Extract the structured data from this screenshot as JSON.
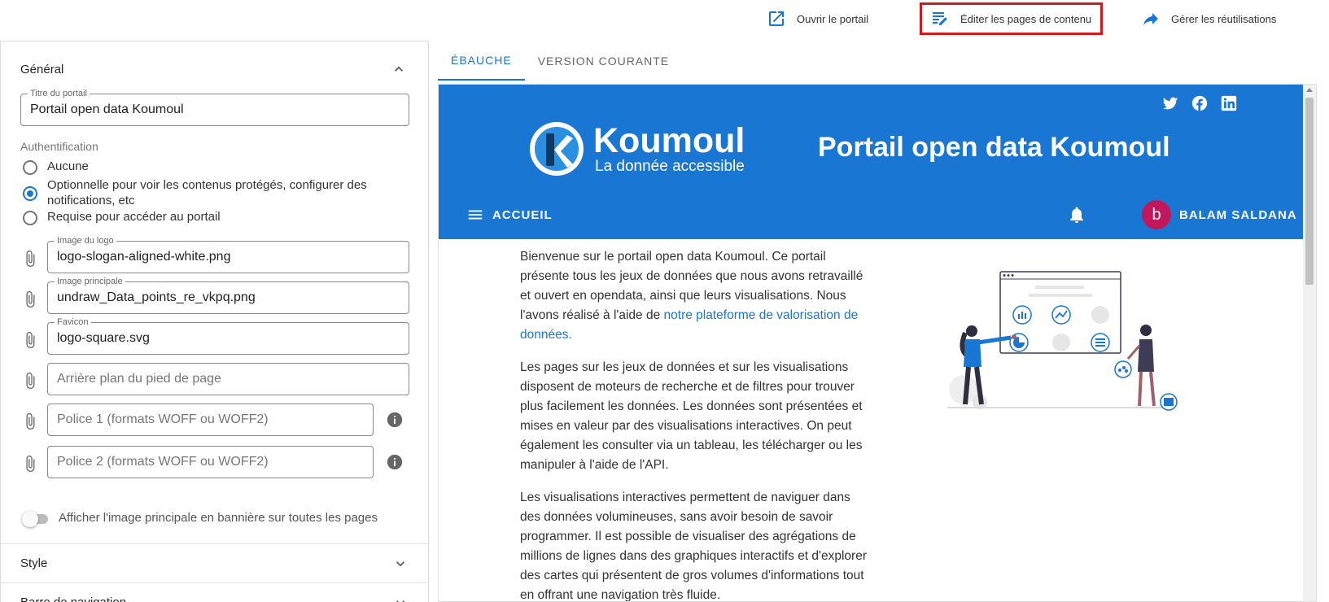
{
  "toolbar": {
    "open_portal": "Ouvrir le portail",
    "edit_pages": "Éditer les pages de contenu",
    "manage_reuses": "Gérer les réutilisations",
    "highlight_color": "#d4171d"
  },
  "sidebar": {
    "general": {
      "title": "Général",
      "portal_title": {
        "label": "Titre du portail",
        "value": "Portail open data Koumoul"
      },
      "auth": {
        "label": "Authentification",
        "options": [
          "Aucune",
          "Optionnelle pour voir les contenus protégés, configurer des notifications, etc",
          "Requise pour accéder au portail"
        ],
        "selected": 1
      },
      "logo": {
        "label": "Image du logo",
        "value": "logo-slogan-aligned-white.png"
      },
      "main_image": {
        "label": "Image principale",
        "value": "undraw_Data_points_re_vkpq.png"
      },
      "favicon": {
        "label": "Favicon",
        "value": "logo-square.svg"
      },
      "footer_bg": {
        "placeholder": "Arrière plan du pied de page"
      },
      "font1": {
        "placeholder": "Police 1 (formats WOFF ou WOFF2)"
      },
      "font2": {
        "placeholder": "Police 2 (formats WOFF ou WOFF2)"
      },
      "banner_switch": {
        "label": "Afficher l'image principale en bannière sur toutes les pages",
        "on": false
      }
    },
    "style": {
      "title": "Style"
    },
    "navbar": {
      "title": "Barre de navigation"
    }
  },
  "preview": {
    "tabs": [
      "ÉBAUCHE",
      "VERSION COURANTE"
    ],
    "active_tab": 0,
    "brand_color": "#1976d2",
    "logo_name": "Koumoul",
    "logo_slogan": "La donnée accessible",
    "hero_title": "Portail open data Koumoul",
    "nav_menu": "ACCUEIL",
    "user_initial": "b",
    "user_name": "BALAM SALDANA",
    "avatar_color": "#c2185b",
    "social_icons": [
      "twitter-icon",
      "facebook-icon",
      "linkedin-icon"
    ],
    "p1_text": "Bienvenue sur le portail open data Koumoul. Ce portail présente tous les jeux de données que nous avons retravaillé et ouvert en opendata, ainsi que leurs visualisations. Nous l'avons réalisé à l'aide de",
    "p1_link": "notre plateforme de valorisation de données.",
    "p2_text": "Les pages sur les jeux de données et sur les visualisations disposent de moteurs de recherche et de filtres pour trouver plus facilement les données. Les données sont présentées et mises en valeur par des visualisations interactives. On peut également les consulter via un tableau, les télécharger ou les manipuler à l'aide de l'API.",
    "p3_text": "Les visualisations interactives permettent de naviguer dans des données volumineuses, sans avoir besoin de savoir programmer. Il est possible de visualiser des agrégations de millions de lignes dans des graphiques interactifs et d'explorer des cartes qui présentent de gros volumes d'informations tout en offrant une navigation très fluide."
  }
}
